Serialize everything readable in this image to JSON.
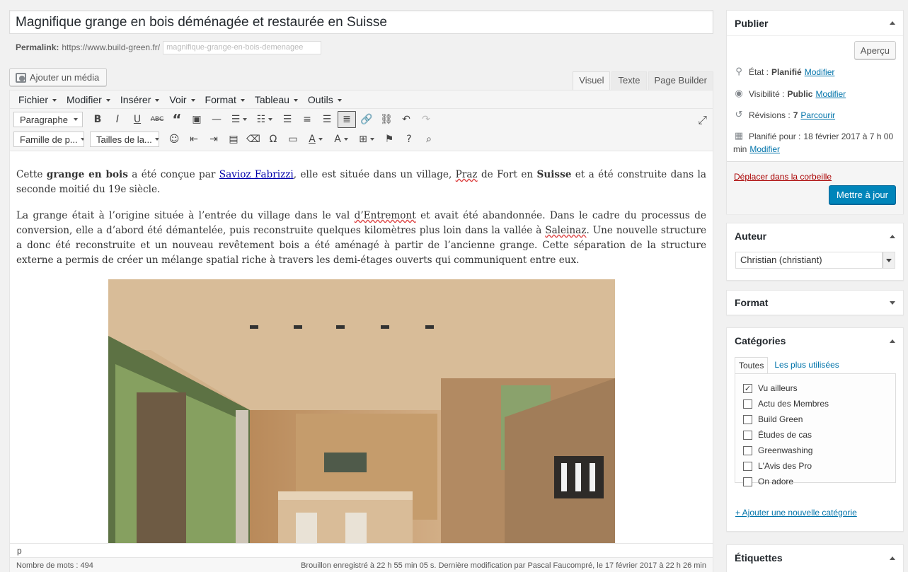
{
  "post": {
    "title": "Magnifique grange en bois déménagée et restaurée en Suisse",
    "permalink_label": "Permalink:",
    "permalink_base": "https://www.build-green.fr/",
    "permalink_slug": "magnifique-grange-en-bois-demenagee"
  },
  "media_button": "Ajouter un média",
  "editor_tabs": [
    "Visuel",
    "Texte",
    "Page Builder"
  ],
  "menubar": [
    "Fichier",
    "Modifier",
    "Insérer",
    "Voir",
    "Format",
    "Tableau",
    "Outils"
  ],
  "toolbar": {
    "format_select": "Paragraphe",
    "font_family_select": "Famille de p...",
    "font_size_select": "Tailles de la..."
  },
  "content": {
    "p1": {
      "t1": "Cette ",
      "b1": "grange en bois",
      "t2": " a été conçue par ",
      "link": "Savioz Fabrizzi",
      "t3": ", elle est située dans un village, ",
      "sq1": "Praz",
      "t4": " de Fort en ",
      "b2": "Suisse",
      "t5": " et a été construite dans la seconde moitié du 19e siècle."
    },
    "p2": {
      "t1": "La grange était à l’origine située à l’entrée du village dans le val ",
      "sq1": "d’Entremont",
      "t2": " et avait été abandonnée. Dans le cadre du processus de conversion, elle a d’abord été démantelée, puis reconstruite quelques kilomètres plus loin dans la vallée à ",
      "sq2": "Saleinaz",
      "t3": ". Une nouvelle structure a donc été reconstruite et un nouveau revêtement bois a été aménagé à partir de l’ancienne grange. Cette séparation de la structure externe a permis de créer un mélange spatial riche à travers les demi-étages ouverts qui communiquent entre eux."
    }
  },
  "status_path": "p",
  "word_count": "Nombre de mots : 494",
  "draft_status": "Brouillon enregistré à 22 h 55 min 05 s. Dernière modification par Pascal Faucompré, le 17 février 2017 à 22 h 26 min",
  "publish": {
    "title": "Publier",
    "preview": "Aperçu",
    "state_label": "État :",
    "state_value": "Planifié",
    "visibility_label": "Visibilité :",
    "visibility_value": "Public",
    "revisions_label": "Révisions :",
    "revisions_value": "7",
    "revisions_link": "Parcourir",
    "scheduled_label": "Planifié pour :",
    "scheduled_value": "18 février 2017 à 7 h 00",
    "scheduled_cont": "min",
    "modify": "Modifier",
    "trash": "Déplacer dans la corbeille",
    "update": "Mettre à jour"
  },
  "author": {
    "title": "Auteur",
    "selected": "Christian (christiant)"
  },
  "format_box": {
    "title": "Format"
  },
  "categories": {
    "title": "Catégories",
    "tab_all": "Toutes",
    "tab_popular": "Les plus utilisées",
    "items": [
      {
        "label": "Vu ailleurs",
        "checked": true
      },
      {
        "label": "Actu des Membres",
        "checked": false
      },
      {
        "label": "Build Green",
        "checked": false
      },
      {
        "label": "Études de cas",
        "checked": false
      },
      {
        "label": "Greenwashing",
        "checked": false
      },
      {
        "label": "L'Avis des Pro",
        "checked": false
      },
      {
        "label": "On adore",
        "checked": false
      }
    ],
    "add_new": "+ Ajouter une nouvelle catégorie"
  },
  "tags_box": {
    "title": "Étiquettes"
  },
  "colors": {
    "primary": "#0085ba",
    "link": "#0073aa",
    "trash": "#a00000"
  }
}
